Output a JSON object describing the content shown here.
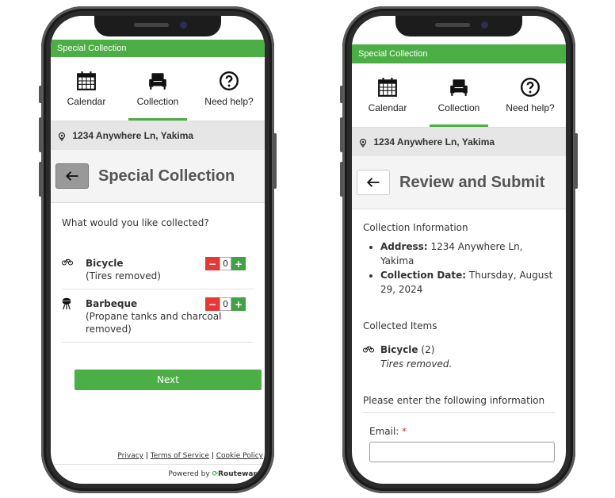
{
  "left": {
    "app_title": "Special Collection",
    "tabs": [
      {
        "label": "Calendar"
      },
      {
        "label": "Collection"
      },
      {
        "label": "Need help?"
      }
    ],
    "address": "1234 Anywhere Ln, Yakima",
    "page_title": "Special Collection",
    "question": "What would you like collected?",
    "items": [
      {
        "name": "Bicycle",
        "note": "(Tires removed)",
        "count": "0",
        "icon": "bicycle-icon"
      },
      {
        "name": "Barbeque",
        "note": "(Propane tanks and charcoal removed)",
        "count": "0",
        "icon": "barbeque-icon"
      }
    ],
    "next_label": "Next",
    "footer": {
      "privacy": "Privacy",
      "terms": "Terms of Service",
      "cookie": "Cookie Policy",
      "powered_by": "Powered by",
      "brand": "Routeware"
    }
  },
  "right": {
    "app_title": "Special Collection",
    "tabs": [
      {
        "label": "Calendar"
      },
      {
        "label": "Collection"
      },
      {
        "label": "Need help?"
      }
    ],
    "address": "1234 Anywhere Ln, Yakima",
    "page_title": "Review and Submit",
    "collection_info_label": "Collection Information",
    "address_label": "Address:",
    "address_value": "1234 Anywhere Ln, Yakima",
    "date_label": "Collection Date:",
    "date_value": "Thursday, August 29, 2024",
    "collected_items_label": "Collected Items",
    "collected_item_name": "Bicycle",
    "collected_item_count": "(2)",
    "collected_item_note": "Tires removed.",
    "please_enter": "Please enter the following information",
    "email_label": "Email:",
    "required_mark": "*"
  },
  "colors": {
    "brand_green": "#4caf45",
    "minus_red": "#e53935",
    "plus_green": "#43a047"
  }
}
